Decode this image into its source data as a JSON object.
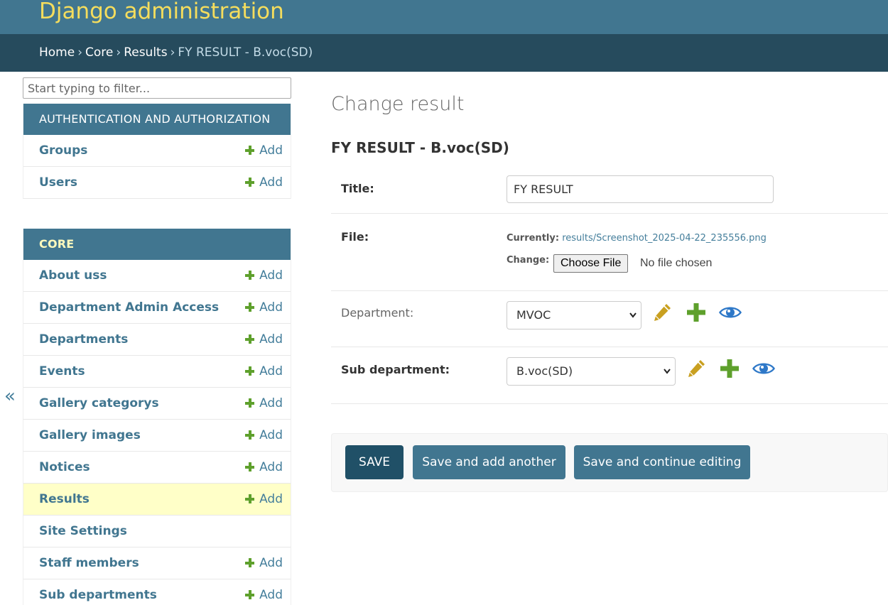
{
  "header": {
    "site_name": "Django administration"
  },
  "breadcrumbs": {
    "items": [
      "Home",
      "Core",
      "Results"
    ],
    "current": "FY RESULT - B.voc(SD)",
    "separator": "›"
  },
  "sidebar": {
    "filter_placeholder": "Start typing to filter...",
    "collapse_symbol": "«",
    "add_label": "Add",
    "apps": [
      {
        "name": "AUTHENTICATION AND AUTHORIZATION",
        "models": [
          {
            "name": "Groups",
            "has_add": true
          },
          {
            "name": "Users",
            "has_add": true
          }
        ]
      },
      {
        "name": "CORE",
        "models": [
          {
            "name": "About uss",
            "has_add": true
          },
          {
            "name": "Department Admin Access",
            "has_add": true
          },
          {
            "name": "Departments",
            "has_add": true
          },
          {
            "name": "Events",
            "has_add": true
          },
          {
            "name": "Gallery categorys",
            "has_add": true
          },
          {
            "name": "Gallery images",
            "has_add": true
          },
          {
            "name": "Notices",
            "has_add": true
          },
          {
            "name": "Results",
            "has_add": true,
            "selected": true
          },
          {
            "name": "Site Settings",
            "has_add": false
          },
          {
            "name": "Staff members",
            "has_add": true
          },
          {
            "name": "Sub departments",
            "has_add": true
          }
        ]
      }
    ]
  },
  "content": {
    "page_title": "Change result",
    "object_title": "FY RESULT - B.voc(SD)",
    "form": {
      "title": {
        "label": "Title:",
        "value": "FY RESULT"
      },
      "file": {
        "label": "File:",
        "currently_label": "Currently:",
        "current_file": "results/Screenshot_2025-04-22_235556.png",
        "change_label": "Change:",
        "choose_button": "Choose File",
        "no_file_text": "No file chosen"
      },
      "department": {
        "label": "Department:",
        "selected": "MVOC"
      },
      "sub_department": {
        "label": "Sub department:",
        "selected": "B.voc(SD)"
      }
    },
    "submit": {
      "save": "SAVE",
      "save_add_another": "Save and add another",
      "save_continue": "Save and continue editing"
    }
  },
  "colors": {
    "header_bg": "#417690",
    "breadcrumb_bg": "#264b5d",
    "site_name": "#f5dd5d",
    "link": "#417690",
    "add_plus": "#5ea02c",
    "selected_row": "#ffffc8",
    "edit_pencil": "#c9a020",
    "view_eye": "#2e78c8",
    "save_button": "#205067"
  },
  "icons": {
    "change": "pencil-icon",
    "add": "plus-icon",
    "view": "eye-icon"
  }
}
